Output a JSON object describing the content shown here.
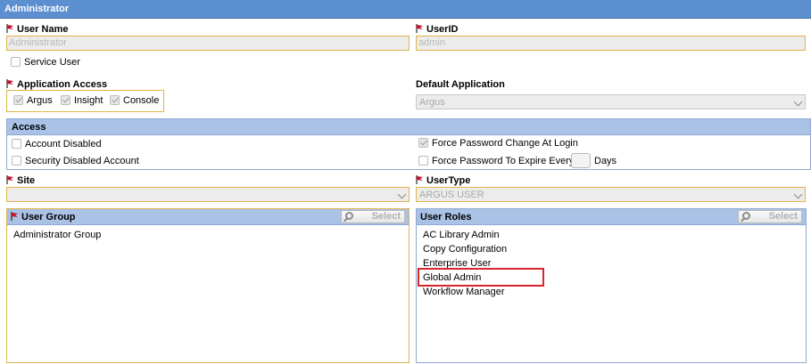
{
  "title": "Administrator",
  "user_name": {
    "label": "User Name",
    "value": "Administrator"
  },
  "user_id": {
    "label": "UserID",
    "value": "admin"
  },
  "service_user": {
    "label": "Service User"
  },
  "app_access": {
    "label": "Application Access",
    "items": [
      "Argus",
      "Insight",
      "Console"
    ]
  },
  "default_app": {
    "label": "Default Application",
    "value": "Argus"
  },
  "access": {
    "header": "Access",
    "account_disabled": "Account Disabled",
    "security_disabled": "Security Disabled Account",
    "force_pw_change": "Force Password Change At Login",
    "force_pw_expire": "Force Password To Expire Every",
    "days": "Days"
  },
  "site": {
    "label": "Site",
    "value": ""
  },
  "user_type": {
    "label": "UserType",
    "value": "ARGUS USER"
  },
  "user_group": {
    "header": "User Group",
    "select_label": "Select",
    "items": [
      "Administrator Group"
    ]
  },
  "user_roles": {
    "header": "User Roles",
    "select_label": "Select",
    "items": [
      "AC Library Admin",
      "Copy Configuration",
      "Enterprise User",
      "Global Admin",
      "Workflow Manager"
    ],
    "highlighted": "Global Admin"
  },
  "colors": {
    "title_bar": "#5b8fd0",
    "section_header": "#a9c2e6",
    "required_border": "#e0b44c",
    "highlight": "#d9242b",
    "flag": "#c8102e"
  }
}
